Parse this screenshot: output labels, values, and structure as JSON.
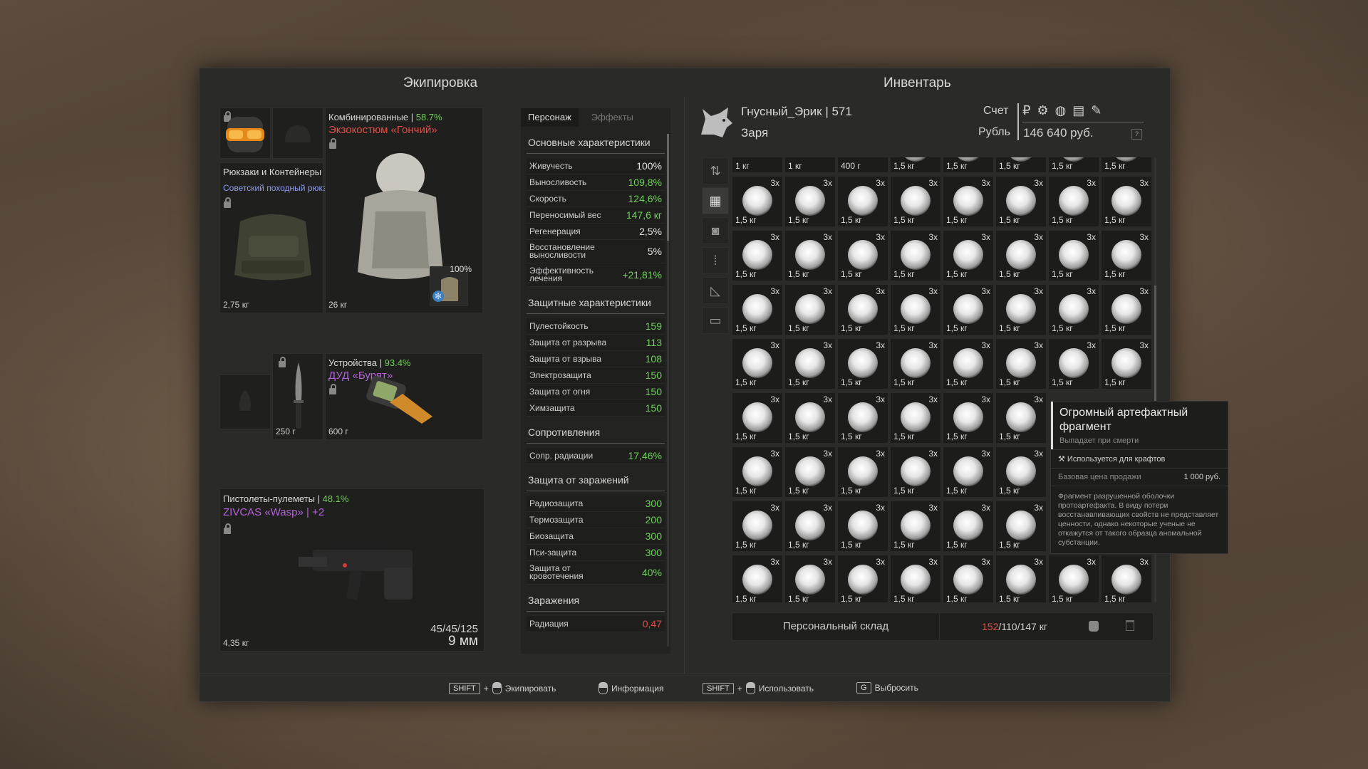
{
  "equipment": {
    "title": "Экипировка",
    "backpack": {
      "label": "Рюкзаки и Контейнеры",
      "name": "Советский походный рюкз...",
      "weight": "2,75 кг"
    },
    "armor": {
      "category": "Комбинированные",
      "sep": " | ",
      "condition": "58.7%",
      "name": "Экзокостюм «Гончий»",
      "weight": "26 кг",
      "plate_condition": "100%"
    },
    "knife": {
      "weight": "250 г"
    },
    "device": {
      "category": "Устройства",
      "sep": " | ",
      "condition": "93.4%",
      "name": "ДУД «Бурят»",
      "weight": "600 г"
    },
    "weapon": {
      "category": "Пистолеты-пулеметы",
      "sep": " | ",
      "condition": "48.1%",
      "name": "ZIVCAS «Wasp»",
      "upgrade": " | +2",
      "weight": "4,35 кг",
      "ammo_count": "45/45/125",
      "caliber": "9 мм"
    }
  },
  "stats": {
    "tabs": [
      "Персонаж",
      "Эффекты"
    ],
    "main": {
      "title": "Основные характеристики",
      "rows": [
        {
          "name": "Живучесть",
          "value": "100%"
        },
        {
          "name": "Выносливость",
          "value": "109,8%"
        },
        {
          "name": "Скорость",
          "value": "124,6%"
        },
        {
          "name": "Переносимый вес",
          "value": "147,6 кг"
        },
        {
          "name": "Регенерация",
          "value": "2,5%"
        },
        {
          "name": "Восстановление выносливости",
          "value": "5%"
        },
        {
          "name": "Эффективность лечения",
          "value": "+21,81%"
        }
      ]
    },
    "protection": {
      "title": "Защитные характеристики",
      "rows": [
        {
          "name": "Пулестойкость",
          "value": "159"
        },
        {
          "name": "Защита от разрыва",
          "value": "113"
        },
        {
          "name": "Защита от взрыва",
          "value": "108"
        },
        {
          "name": "Электрозащита",
          "value": "150"
        },
        {
          "name": "Защита от огня",
          "value": "150"
        },
        {
          "name": "Химзащита",
          "value": "150"
        }
      ]
    },
    "resist": {
      "title": "Сопротивления",
      "rows": [
        {
          "name": "Сопр. радиации",
          "value": "17,46%"
        }
      ]
    },
    "infection_protection": {
      "title": "Защита от заражений",
      "rows": [
        {
          "name": "Радиозащита",
          "value": "300"
        },
        {
          "name": "Термозащита",
          "value": "200"
        },
        {
          "name": "Биозащита",
          "value": "300"
        },
        {
          "name": "Пси-защита",
          "value": "300"
        },
        {
          "name": "Защита от кровотечения",
          "value": "40%"
        }
      ]
    },
    "infections": {
      "title": "Заражения",
      "rows": [
        {
          "name": "Радиация",
          "value": "0,47"
        }
      ]
    }
  },
  "inventory": {
    "title": "Инвентарь",
    "character": "Гнусный_Эрик | 571",
    "faction": "Заря",
    "account_label": "Счет",
    "currency_label": "Рубль",
    "currency_icons": "₽ ⚙ ◍ ▤ ✎",
    "money": "146 640 руб.",
    "help": "?",
    "top_row_weights": [
      "1 кг",
      "1 кг",
      "400 г",
      "1,5 кг",
      "1,5 кг",
      "1,5 кг",
      "1,5 кг",
      "1,5 кг"
    ],
    "item_qty": "3x",
    "item_weight": "1,5 кг",
    "stash_label": "Персональный склад",
    "weight_current": "152",
    "weight_rest": "/110/147 кг"
  },
  "tooltip": {
    "title": "Огромный артефактный фрагмент",
    "subtitle": "Выпадает при смерти",
    "usage": "Используется для крафтов",
    "price_label": "Базовая цена продажи",
    "price": "1 000 руб.",
    "description": "Фрагмент разрушенной оболочки протоартефакта. В виду потери восстанавливающих свойств не представляет ценности, однако некоторые ученые не откажутся от такого образца аномальной субстанции."
  },
  "footer": {
    "shift": "SHIFT",
    "plus": "+",
    "equip": "Экипировать",
    "info": "Информация",
    "use": "Использовать",
    "g_key": "G",
    "drop": "Выбросить"
  },
  "colors": {
    "good": "#6fcf5a",
    "bad": "#e0504a",
    "legendary": "#b464d8",
    "rare": "#8c9af0"
  }
}
